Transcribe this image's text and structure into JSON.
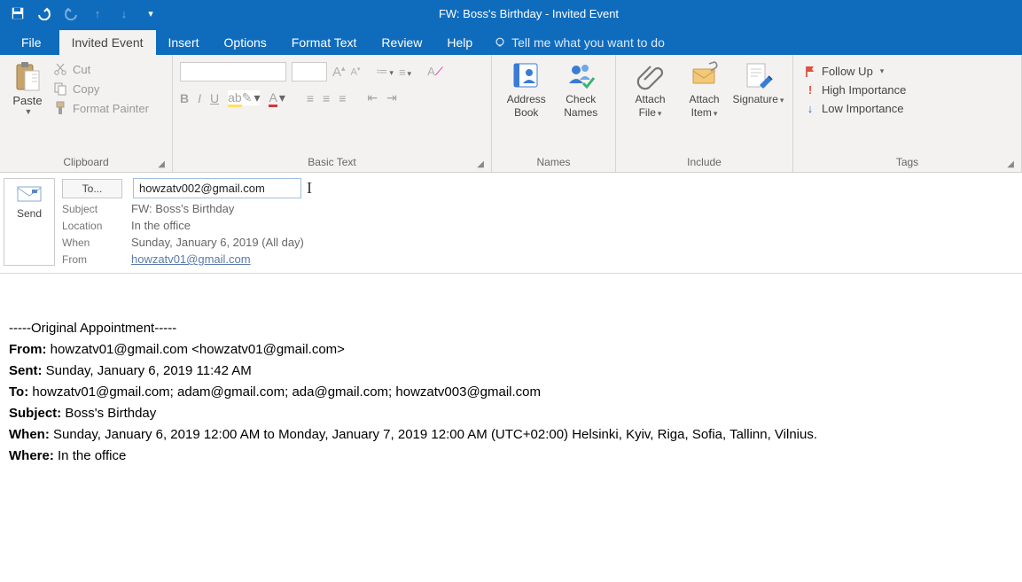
{
  "title": "FW: Boss's Birthday  -  Invited Event",
  "tabs": {
    "file": "File",
    "invited": "Invited Event",
    "insert": "Insert",
    "options": "Options",
    "format": "Format Text",
    "review": "Review",
    "help": "Help",
    "tellme": "Tell me what you want to do"
  },
  "ribbon": {
    "clipboard": {
      "paste": "Paste",
      "cut": "Cut",
      "copy": "Copy",
      "painter": "Format Painter",
      "group_label": "Clipboard"
    },
    "basic_text": {
      "group_label": "Basic Text"
    },
    "names": {
      "address_book": "Address Book",
      "check_names": "Check Names",
      "group_label": "Names"
    },
    "include": {
      "attach_file": "Attach File",
      "attach_item": "Attach Item",
      "signature": "Signature",
      "group_label": "Include"
    },
    "tags": {
      "follow_up": "Follow Up",
      "high": "High Importance",
      "low": "Low Importance",
      "group_label": "Tags"
    }
  },
  "header": {
    "send": "Send",
    "to_label": "To...",
    "to_value": "howzatv002@gmail.com",
    "subject_label": "Subject",
    "subject_value": "FW: Boss's Birthday",
    "location_label": "Location",
    "location_value": "In the office",
    "when_label": "When",
    "when_value": "Sunday, January 6, 2019 (All day)",
    "from_label": "From",
    "from_value": "howzatv01@gmail.com"
  },
  "body": {
    "divider": "-----Original Appointment-----",
    "from_label": "From:",
    "from_value": "howzatv01@gmail.com <howzatv01@gmail.com>",
    "sent_label": "Sent:",
    "sent_value": "Sunday, January 6, 2019 11:42 AM",
    "to_label": "To:",
    "to_value": "howzatv01@gmail.com; adam@gmail.com; ada@gmail.com; howzatv003@gmail.com",
    "subject_label": "Subject:",
    "subject_value": "Boss's Birthday",
    "when_label": "When:",
    "when_value": "Sunday, January 6, 2019 12:00 AM to Monday, January 7, 2019 12:00 AM (UTC+02:00) Helsinki, Kyiv, Riga, Sofia, Tallinn, Vilnius.",
    "where_label": "Where:",
    "where_value": "In the office"
  }
}
